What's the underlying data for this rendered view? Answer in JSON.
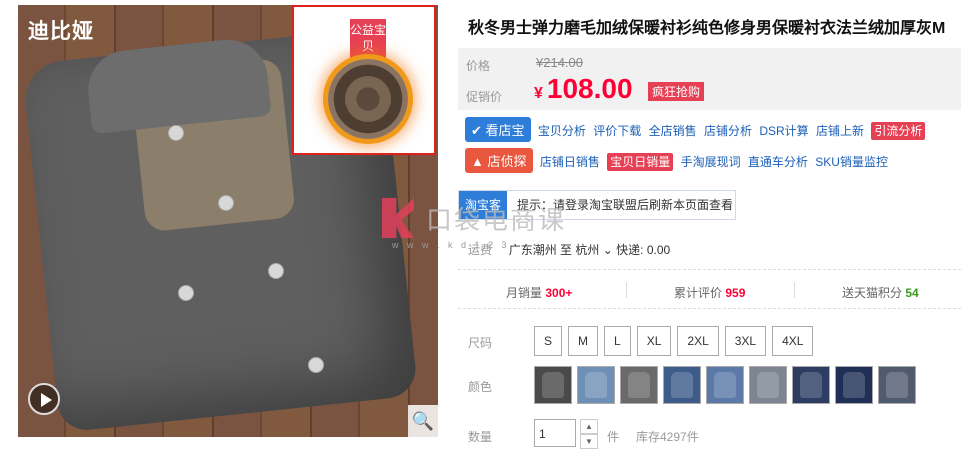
{
  "image": {
    "brand": "迪比娅",
    "charity_tag": "公益宝贝",
    "video_icon": "play-icon",
    "zoom_icon": "magnifier-icon"
  },
  "product": {
    "title": "秋冬男士弹力磨毛加绒保暖衬衫纯色修身男保暖衬衣法兰绒加厚灰M"
  },
  "price": {
    "label": "价格",
    "original": "¥214.00",
    "promo_label": "促销价",
    "currency": "¥",
    "current": "108.00",
    "promo_tag": "疯狂抢购"
  },
  "plugins": {
    "kandianbao": {
      "label": "看店宝",
      "links": [
        "宝贝分析",
        "评价下载",
        "全店销售",
        "店铺分析",
        "DSR计算",
        "店铺上新"
      ],
      "highlight": "引流分析"
    },
    "dianzhentan": {
      "label": "店侦探",
      "links_before": [
        "店铺日销售"
      ],
      "highlight": "宝贝日销量",
      "links_after": [
        "手淘展现词",
        "直通车分析",
        "SKU销量监控"
      ]
    }
  },
  "tip": {
    "tag": "淘宝客",
    "text": "提示：请登录淘宝联盟后刷新本页面查看"
  },
  "watermark": {
    "text": "口袋电商课",
    "url": "w w w . k d 1 2 3"
  },
  "shipping": {
    "label": "运费",
    "from": "广东潮州",
    "to_label": "至",
    "to": "杭州",
    "express": "快递: 0.00"
  },
  "stats": {
    "monthly_sales_label": "月销量",
    "monthly_sales": "300+",
    "reviews_label": "累计评价",
    "reviews": "959",
    "points_label": "送天猫积分",
    "points": "54"
  },
  "options": {
    "size_label": "尺码",
    "sizes": [
      "S",
      "M",
      "L",
      "XL",
      "2XL",
      "3XL",
      "4XL"
    ],
    "color_label": "颜色",
    "color_swatches": [
      "#4a4a4a",
      "#6f8fb5",
      "#6a6a6a",
      "#3e5c8a",
      "#5b7aa8",
      "#7c8590",
      "#2e3e63",
      "#1f2f55",
      "#515b70"
    ]
  },
  "quantity": {
    "label": "数量",
    "value": "1",
    "unit": "件",
    "stock": "库存4297件"
  }
}
